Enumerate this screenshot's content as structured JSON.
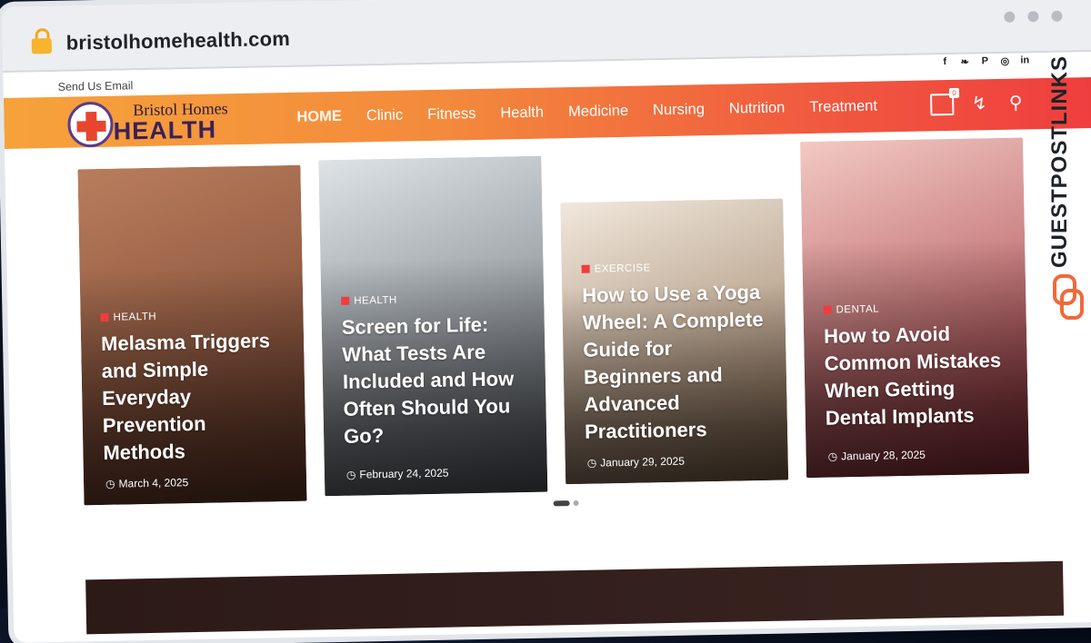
{
  "browser": {
    "url": "bristolhomehealth.com"
  },
  "topbar": {
    "send_email": "Send Us Email",
    "social_icons": [
      "facebook-icon",
      "twitter-icon",
      "pinterest-icon",
      "instagram-icon",
      "linkedin-icon"
    ],
    "social_glyphs": [
      "f",
      "❧",
      "P",
      "◎",
      "in"
    ]
  },
  "logo": {
    "line1": "Bristol Homes",
    "line2": "HEALTH"
  },
  "nav": {
    "items": [
      "HOME",
      "Clinic",
      "Fitness",
      "Health",
      "Medicine",
      "Nursing",
      "Nutrition",
      "Treatment"
    ],
    "bookmark_count": "0",
    "icons": [
      "bookmark-icon",
      "flash-icon",
      "search-icon"
    ]
  },
  "slides": [
    {
      "category": "HEALTH",
      "title": "Melasma Triggers and Simple Everyday Prevention Methods",
      "date": "March 4, 2025",
      "tone": [
        "#b97d5c",
        "#6b3b2a"
      ]
    },
    {
      "category": "HEALTH",
      "title": "Screen for Life: What Tests Are Included and How Often Should You Go?",
      "date": "February 24, 2025",
      "tone": [
        "#dde3e6",
        "#5a5f66"
      ]
    },
    {
      "category": "EXERCISE",
      "title": "How to Use a Yoga Wheel: A Complete Guide for Beginners and Advanced Practitioners",
      "date": "January 29, 2025",
      "tone": [
        "#f1e8dc",
        "#8a6a4e"
      ]
    },
    {
      "category": "DENTAL",
      "title": "How to Avoid Common Mistakes When Getting Dental Implants",
      "date": "January 28, 2025",
      "tone": [
        "#f3c9c3",
        "#9b2f38"
      ]
    }
  ],
  "watermark": {
    "text": "GUESTPOSTLINKS"
  },
  "colors": {
    "nav_start": "#f6a23b",
    "nav_end": "#ef3d3e",
    "accent": "#ef3d3e"
  }
}
